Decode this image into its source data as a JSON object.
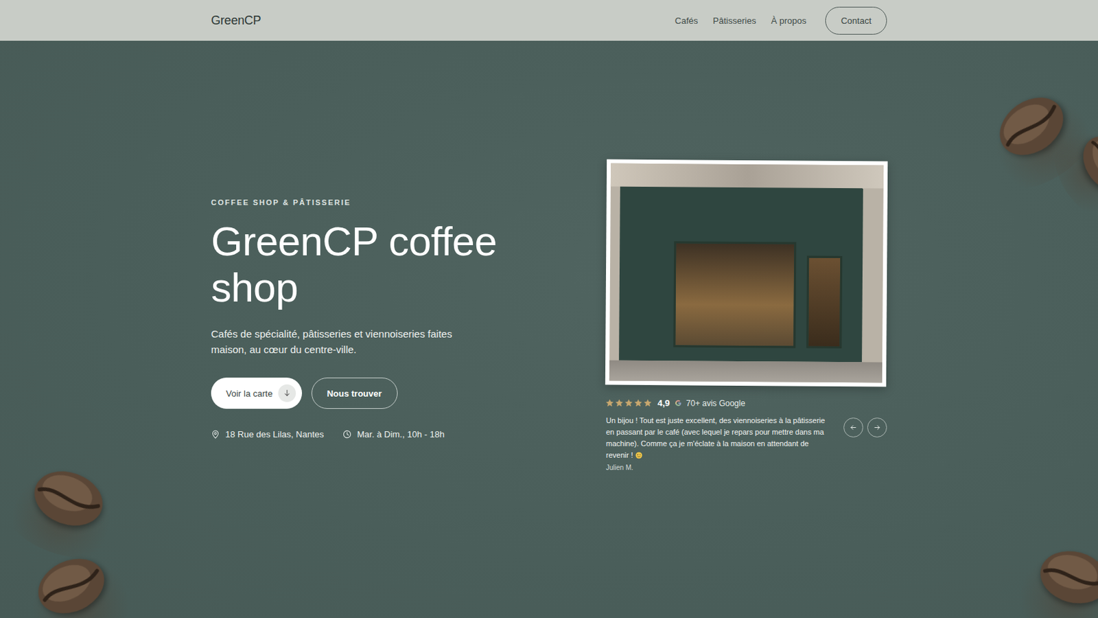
{
  "nav": {
    "logo": "GreenCP",
    "links": [
      {
        "label": "Cafés"
      },
      {
        "label": "Pâtisseries"
      },
      {
        "label": "À propos"
      }
    ],
    "contact": "Contact"
  },
  "hero": {
    "eyebrow": "COFFEE SHOP & PÂTISSERIE",
    "title": "GreenCP coffee shop",
    "subtitle": "Cafés de spécialité, pâtisseries et viennoiseries faites maison, au cœur du centre-ville.",
    "buttons": [
      {
        "label": "Voir la carte",
        "kind": "primary"
      },
      {
        "label": "Nous trouver",
        "kind": "secondary"
      }
    ],
    "address": "18 Rue des Lilas, Nantes",
    "hours": "Mar. à Dim., 10h - 18h"
  },
  "reviews": {
    "stars": 5,
    "rating": "4,9",
    "count": "70+ avis Google",
    "text": "Un bijou ! Tout est juste excellent, des viennoiseries à la pâtisserie en passant par le café (avec lequel je repars pour mettre dans ma machine). Comme ça je m'éclate à la maison en attendant de revenir !",
    "author": "Julien M."
  }
}
